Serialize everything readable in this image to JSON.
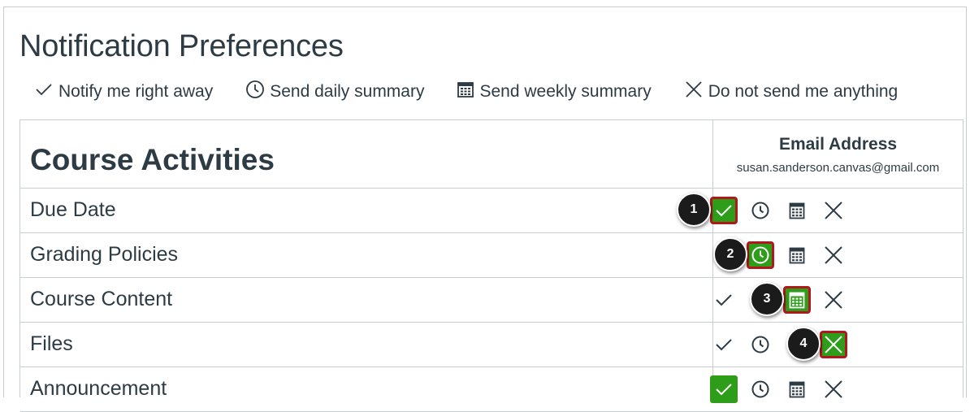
{
  "page": {
    "title": "Notification Preferences"
  },
  "legend": {
    "right_away": "Notify me right away",
    "daily": "Send daily summary",
    "weekly": "Send weekly summary",
    "never": "Do not send me anything"
  },
  "table": {
    "section_title": "Course Activities",
    "channel": {
      "type": "Email Address",
      "address": "susan.sanderson.canvas@gmail.com"
    },
    "rows": [
      {
        "label": "Due Date",
        "selected": "right_away",
        "callout": "1"
      },
      {
        "label": "Grading Policies",
        "selected": "daily",
        "callout": "2"
      },
      {
        "label": "Course Content",
        "selected": "weekly",
        "callout": "3"
      },
      {
        "label": "Files",
        "selected": "never",
        "callout": "4"
      },
      {
        "label": "Announcement",
        "selected": "right_away",
        "callout": ""
      }
    ]
  },
  "icons": {
    "right_away": "check-icon",
    "daily": "clock-icon",
    "weekly": "calendar-icon",
    "never": "x-icon"
  },
  "colors": {
    "selected_bg": "#2e9e1a",
    "highlight_border": "#b0181d",
    "text": "#2d3b45",
    "callout_bg": "#1b1b1b"
  }
}
